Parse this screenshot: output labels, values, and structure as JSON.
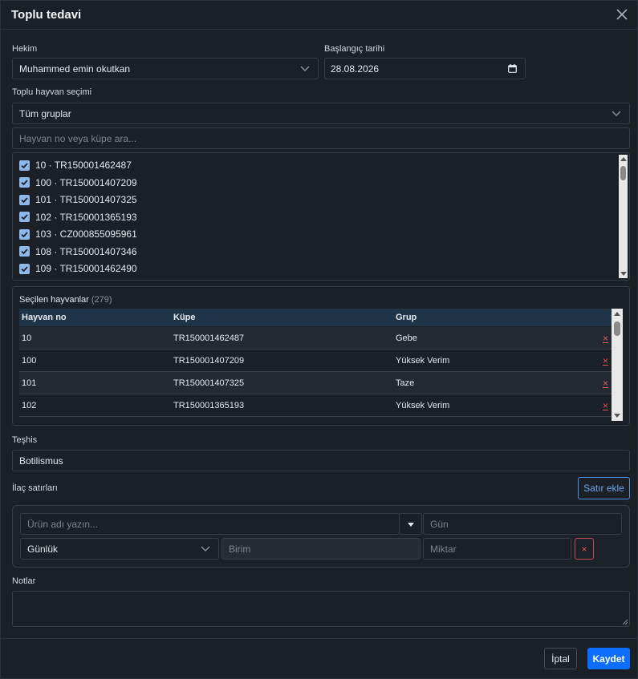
{
  "dialog": {
    "title": "Toplu tedavi"
  },
  "vet": {
    "label": "Hekim",
    "value": "Muhammed emin okutkan"
  },
  "start_date": {
    "label": "Başlangıç tarihi",
    "value": "28.08.2026"
  },
  "bulk": {
    "label": "Toplu hayvan seçimi",
    "group_value": "Tüm gruplar",
    "search_placeholder": "Hayvan no veya küpe ara..."
  },
  "animal_list": [
    {
      "label": "10 · TR150001462487",
      "checked": true
    },
    {
      "label": "100 · TR150001407209",
      "checked": true
    },
    {
      "label": "101 · TR150001407325",
      "checked": true
    },
    {
      "label": "102 · TR150001365193",
      "checked": true
    },
    {
      "label": "103 · CZ000855095961",
      "checked": true
    },
    {
      "label": "108 · TR150001407346",
      "checked": true
    },
    {
      "label": "109 · TR150001462490",
      "checked": true
    }
  ],
  "selected": {
    "title": "Seçilen hayvanlar",
    "count": "(279)",
    "columns": [
      "Hayvan no",
      "Küpe",
      "Grup"
    ],
    "rows": [
      {
        "no": "10",
        "tag": "TR150001462487",
        "group": "Gebe"
      },
      {
        "no": "100",
        "tag": "TR150001407209",
        "group": "Yüksek Verim"
      },
      {
        "no": "101",
        "tag": "TR150001407325",
        "group": "Taze"
      },
      {
        "no": "102",
        "tag": "TR150001365193",
        "group": "Yüksek Verim"
      }
    ],
    "remove_glyph": "×"
  },
  "diagnosis": {
    "label": "Teşhis",
    "value": "Botilismus"
  },
  "drugs": {
    "label": "İlaç satırları",
    "add_button": "Satır ekle",
    "product_placeholder": "Ürün adı yazın...",
    "days_placeholder": "Gün",
    "frequency_value": "Günlük",
    "unit_placeholder": "Birim",
    "amount_placeholder": "Miktar",
    "remove_glyph": "×"
  },
  "notes": {
    "label": "Notlar",
    "value": ""
  },
  "footer": {
    "cancel": "İptal",
    "save": "Kaydet"
  },
  "colors": {
    "accent": "#0d6efd",
    "danger": "#e05a5a",
    "check": "#8fb8ea",
    "table_header": "#1f3349"
  }
}
